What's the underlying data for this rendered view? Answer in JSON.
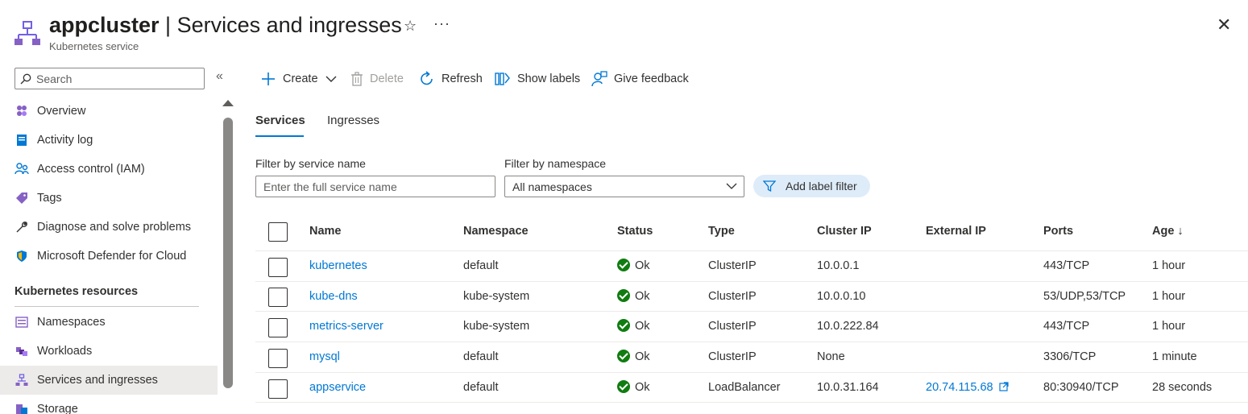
{
  "header": {
    "resource_name": "appcluster",
    "separator": " | ",
    "page_name": "Services and ingresses",
    "subtitle": "Kubernetes service",
    "star_icon": "star-icon",
    "more_icon": "ellipsis-icon",
    "close_icon": "close-icon"
  },
  "sidebar": {
    "search_placeholder": "Search",
    "collapse_icon": "double-chevron-left-icon",
    "items": [
      {
        "label": "Overview",
        "icon": "overview-icon"
      },
      {
        "label": "Activity log",
        "icon": "activity-log-icon"
      },
      {
        "label": "Access control (IAM)",
        "icon": "people-icon"
      },
      {
        "label": "Tags",
        "icon": "tag-icon"
      },
      {
        "label": "Diagnose and solve problems",
        "icon": "wrench-icon"
      },
      {
        "label": "Microsoft Defender for Cloud",
        "icon": "shield-icon"
      }
    ],
    "section_label": "Kubernetes resources",
    "section_items": [
      {
        "label": "Namespaces",
        "icon": "namespaces-icon"
      },
      {
        "label": "Workloads",
        "icon": "workloads-icon"
      },
      {
        "label": "Services and ingresses",
        "icon": "services-icon",
        "active": true
      },
      {
        "label": "Storage",
        "icon": "storage-icon"
      }
    ]
  },
  "toolbar": {
    "create": "Create",
    "delete": "Delete",
    "refresh": "Refresh",
    "show_labels": "Show labels",
    "give_feedback": "Give feedback"
  },
  "tabs": [
    {
      "label": "Services",
      "active": true
    },
    {
      "label": "Ingresses",
      "active": false
    }
  ],
  "filters": {
    "service_name_label": "Filter by service name",
    "service_name_placeholder": "Enter the full service name",
    "namespace_label": "Filter by namespace",
    "namespace_value": "All namespaces",
    "add_label_filter": "Add label filter"
  },
  "table": {
    "columns": [
      "Name",
      "Namespace",
      "Status",
      "Type",
      "Cluster IP",
      "External IP",
      "Ports",
      "Age ↓"
    ],
    "rows": [
      {
        "name": "kubernetes",
        "namespace": "default",
        "status": "Ok",
        "type": "ClusterIP",
        "cluster_ip": "10.0.0.1",
        "external_ip": "",
        "ports": "443/TCP",
        "age": "1 hour"
      },
      {
        "name": "kube-dns",
        "namespace": "kube-system",
        "status": "Ok",
        "type": "ClusterIP",
        "cluster_ip": "10.0.0.10",
        "external_ip": "",
        "ports": "53/UDP,53/TCP",
        "age": "1 hour"
      },
      {
        "name": "metrics-server",
        "namespace": "kube-system",
        "status": "Ok",
        "type": "ClusterIP",
        "cluster_ip": "10.0.222.84",
        "external_ip": "",
        "ports": "443/TCP",
        "age": "1 hour"
      },
      {
        "name": "mysql",
        "namespace": "default",
        "status": "Ok",
        "type": "ClusterIP",
        "cluster_ip": "None",
        "external_ip": "",
        "ports": "3306/TCP",
        "age": "1 minute"
      },
      {
        "name": "appservice",
        "namespace": "default",
        "status": "Ok",
        "type": "LoadBalancer",
        "cluster_ip": "10.0.31.164",
        "external_ip": "20.74.115.68",
        "ports": "80:30940/TCP",
        "age": "28 seconds"
      }
    ]
  },
  "colors": {
    "accent": "#0078d4",
    "status_ok": "#107c10",
    "label_filter_bg": "#deecf9",
    "active_nav_bg": "#edebe9"
  }
}
